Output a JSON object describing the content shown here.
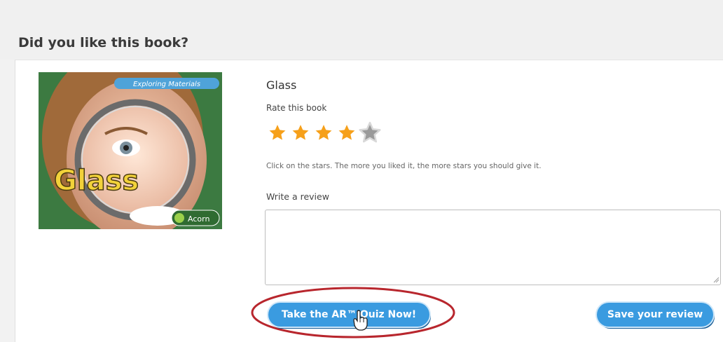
{
  "page": {
    "heading": "Did you like this book?"
  },
  "book": {
    "title": "Glass",
    "cover": {
      "series_banner": "Exploring Materials",
      "title_text": "Glass",
      "publisher_logo": "Acorn"
    }
  },
  "rating": {
    "label": "Rate this book",
    "value": 4,
    "max": 5,
    "help_text": "Click on the stars. The more you liked it, the more stars you should give it.",
    "filled_color": "#f6a01a",
    "empty_color": "#9a9a9a"
  },
  "review": {
    "label": "Write a review",
    "value": "",
    "placeholder": ""
  },
  "actions": {
    "quiz_label": "Take the AR™ Quiz Now!",
    "save_label": "Save your review"
  },
  "colors": {
    "button": "#3a9be0",
    "highlight_ring": "#b8262d"
  },
  "icons": {
    "star": "star-icon",
    "cursor": "hand-pointer-icon"
  }
}
